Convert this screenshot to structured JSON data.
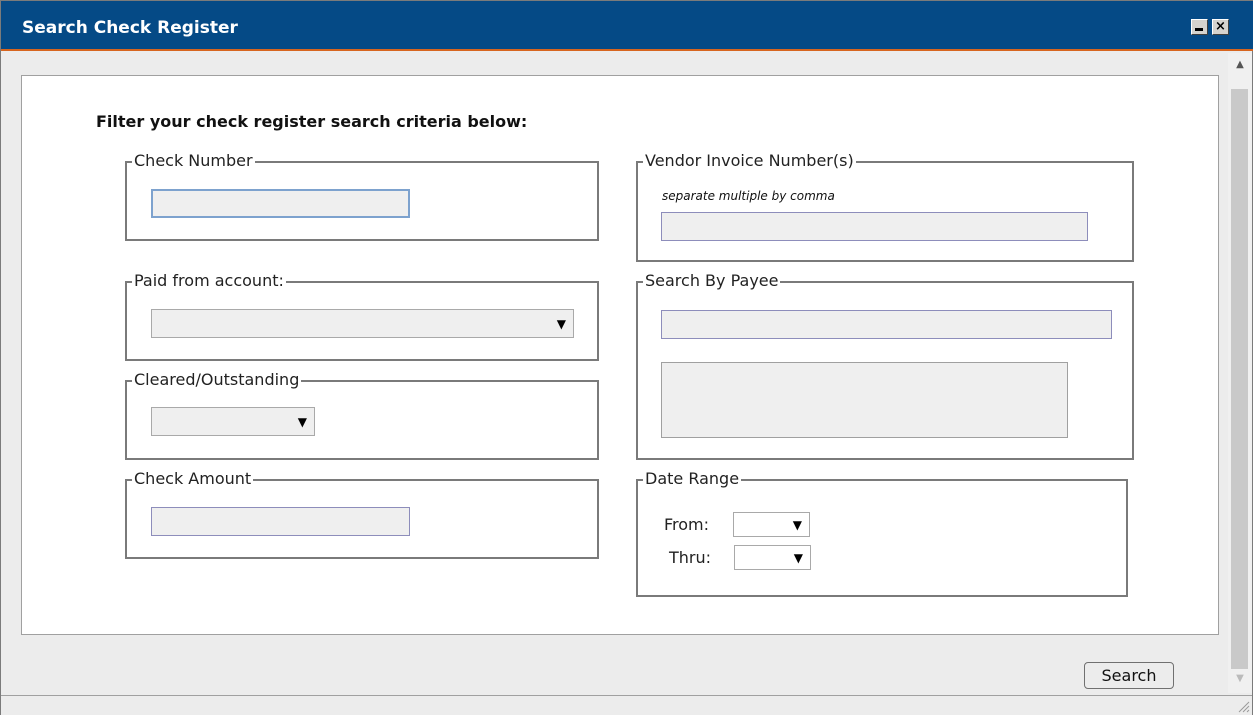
{
  "window": {
    "title": "Search Check Register",
    "minimize_icon": "minimize-icon",
    "close_icon": "close-icon",
    "close_glyph": "×"
  },
  "form": {
    "heading": "Filter your check register search criteria below:",
    "check_number": {
      "legend": "Check Number",
      "value": ""
    },
    "paid_from": {
      "legend": "Paid from account:",
      "value": ""
    },
    "cleared": {
      "legend": "Cleared/Outstanding",
      "value": ""
    },
    "check_amount": {
      "legend": "Check Amount",
      "value": ""
    },
    "vendor_invoice": {
      "legend": "Vendor Invoice Number(s)",
      "hint": "separate multiple by comma",
      "value": ""
    },
    "payee": {
      "legend": "Search By Payee",
      "value": ""
    },
    "date_range": {
      "legend": "Date Range",
      "from_label": "From:",
      "thru_label": "Thru:"
    }
  },
  "actions": {
    "search_label": "Search"
  },
  "icons": {
    "dropdown": "▼",
    "scroll_up": "▲",
    "scroll_down": "▼"
  },
  "colors": {
    "titlebar": "#054a86",
    "title_accent": "#d7651f"
  }
}
